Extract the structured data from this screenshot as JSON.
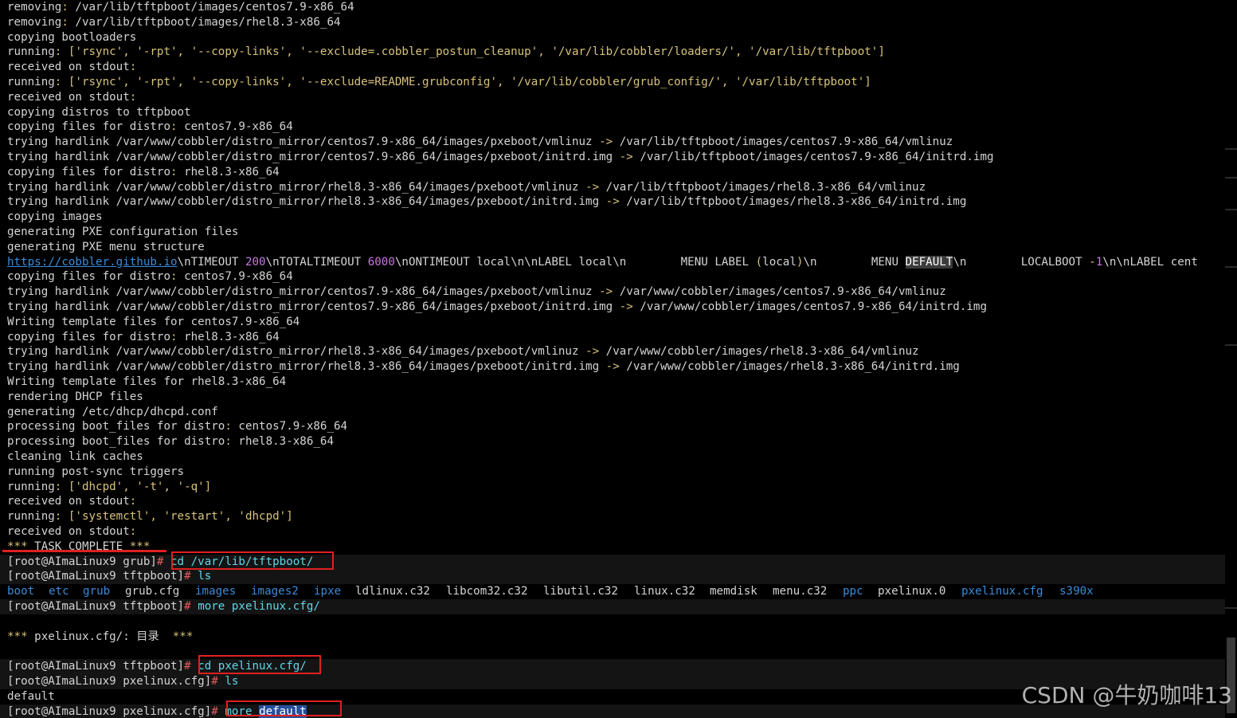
{
  "terminal": {
    "lines": [
      {
        "segments": [
          [
            "w",
            "removing"
          ],
          [
            "y",
            ":"
          ],
          [
            "w",
            " /var/lib/tftpboot/images/centos7.9-x86_64"
          ]
        ]
      },
      {
        "segments": [
          [
            "w",
            "removing"
          ],
          [
            "y",
            ":"
          ],
          [
            "w",
            " /var/lib/tftpboot/images/rhel8.3-x86_64"
          ]
        ]
      },
      {
        "segments": [
          [
            "w",
            "copying bootloaders"
          ]
        ]
      },
      {
        "segments": [
          [
            "w",
            "running"
          ],
          [
            "y",
            ": ['rsync', '-rpt', '--copy-links', '--exclude=.cobbler_postun_cleanup', '/var/lib/cobbler/loaders/', '/var/lib/tftpboot']"
          ]
        ]
      },
      {
        "segments": [
          [
            "w",
            "received on stdout"
          ],
          [
            "y",
            ":"
          ]
        ]
      },
      {
        "segments": [
          [
            "w",
            "running"
          ],
          [
            "y",
            ": ['rsync', '-rpt', '--copy-links', '--exclude=README.grubconfig', '/var/lib/cobbler/grub_config/', '/var/lib/tftpboot']"
          ]
        ]
      },
      {
        "segments": [
          [
            "w",
            "received on stdout"
          ],
          [
            "y",
            ":"
          ]
        ]
      },
      {
        "segments": [
          [
            "w",
            "copying distros to tftpboot"
          ]
        ]
      },
      {
        "segments": [
          [
            "w",
            "copying files for distro"
          ],
          [
            "y",
            ":"
          ],
          [
            "w",
            " centos7.9-x86_64"
          ]
        ]
      },
      {
        "segments": [
          [
            "w",
            "trying hardlink /var/www/cobbler/distro_mirror/centos7.9-x86_64/images/pxeboot/vmlinuz "
          ],
          [
            "y",
            "->"
          ],
          [
            "w",
            " /var/lib/tftpboot/images/centos7.9-x86_64/vmlinuz"
          ]
        ]
      },
      {
        "segments": [
          [
            "w",
            "trying hardlink /var/www/cobbler/distro_mirror/centos7.9-x86_64/images/pxeboot/initrd.img "
          ],
          [
            "y",
            "->"
          ],
          [
            "w",
            " /var/lib/tftpboot/images/centos7.9-x86_64/initrd.img"
          ]
        ]
      },
      {
        "segments": [
          [
            "w",
            "copying files for distro"
          ],
          [
            "y",
            ":"
          ],
          [
            "w",
            " rhel8.3-x86_64"
          ]
        ]
      },
      {
        "segments": [
          [
            "w",
            "trying hardlink /var/www/cobbler/distro_mirror/rhel8.3-x86_64/images/pxeboot/vmlinuz "
          ],
          [
            "y",
            "->"
          ],
          [
            "w",
            " /var/lib/tftpboot/images/rhel8.3-x86_64/vmlinuz"
          ]
        ]
      },
      {
        "segments": [
          [
            "w",
            "trying hardlink /var/www/cobbler/distro_mirror/rhel8.3-x86_64/images/pxeboot/initrd.img "
          ],
          [
            "y",
            "->"
          ],
          [
            "w",
            " /var/lib/tftpboot/images/rhel8.3-x86_64/initrd.img"
          ]
        ]
      },
      {
        "segments": [
          [
            "w",
            "copying images"
          ]
        ]
      },
      {
        "segments": [
          [
            "w",
            "generating PXE configuration files"
          ]
        ]
      },
      {
        "segments": [
          [
            "w",
            "generating PXE menu structure"
          ]
        ]
      },
      {
        "segments": [
          [
            "link",
            "https://cobbler.github.io"
          ],
          [
            "w",
            "\\nTIMEOUT "
          ],
          [
            "num",
            "200"
          ],
          [
            "w",
            "\\nTOTALTIMEOUT "
          ],
          [
            "num",
            "6000"
          ],
          [
            "w",
            "\\nONTIMEOUT local\\n\\nLABEL local\\n        MENU LABEL "
          ],
          [
            "y",
            "("
          ],
          [
            "w",
            "local"
          ],
          [
            "y",
            ")"
          ],
          [
            "w",
            "\\n        MENU "
          ],
          [
            "sel",
            "DEFAULT"
          ],
          [
            "w",
            "\\n        LOCALBOOT "
          ],
          [
            "y",
            "-"
          ],
          [
            "num",
            "1"
          ],
          [
            "w",
            "\\n\\nLABEL cent"
          ]
        ]
      },
      {
        "segments": [
          [
            "w",
            "copying files for distro"
          ],
          [
            "y",
            ":"
          ],
          [
            "w",
            " centos7.9-x86_64"
          ]
        ]
      },
      {
        "segments": [
          [
            "w",
            "trying hardlink /var/www/cobbler/distro_mirror/centos7.9-x86_64/images/pxeboot/vmlinuz "
          ],
          [
            "y",
            "->"
          ],
          [
            "w",
            " /var/www/cobbler/images/centos7.9-x86_64/vmlinuz"
          ]
        ]
      },
      {
        "segments": [
          [
            "w",
            "trying hardlink /var/www/cobbler/distro_mirror/centos7.9-x86_64/images/pxeboot/initrd.img "
          ],
          [
            "y",
            "->"
          ],
          [
            "w",
            " /var/www/cobbler/images/centos7.9-x86_64/initrd.img"
          ]
        ]
      },
      {
        "segments": [
          [
            "w",
            "Writing template files for centos7.9-x86_64"
          ]
        ]
      },
      {
        "segments": [
          [
            "w",
            "copying files for distro"
          ],
          [
            "y",
            ":"
          ],
          [
            "w",
            " rhel8.3-x86_64"
          ]
        ]
      },
      {
        "segments": [
          [
            "w",
            "trying hardlink /var/www/cobbler/distro_mirror/rhel8.3-x86_64/images/pxeboot/vmlinuz "
          ],
          [
            "y",
            "->"
          ],
          [
            "w",
            " /var/www/cobbler/images/rhel8.3-x86_64/vmlinuz"
          ]
        ]
      },
      {
        "segments": [
          [
            "w",
            "trying hardlink /var/www/cobbler/distro_mirror/rhel8.3-x86_64/images/pxeboot/initrd.img "
          ],
          [
            "y",
            "->"
          ],
          [
            "w",
            " /var/www/cobbler/images/rhel8.3-x86_64/initrd.img"
          ]
        ]
      },
      {
        "segments": [
          [
            "w",
            "Writing template files for rhel8.3-x86_64"
          ]
        ]
      },
      {
        "segments": [
          [
            "w",
            "rendering DHCP files"
          ]
        ]
      },
      {
        "segments": [
          [
            "w",
            "generating /etc/dhcp/dhcpd.conf"
          ]
        ]
      },
      {
        "segments": [
          [
            "w",
            "processing boot_files for distro"
          ],
          [
            "y",
            ":"
          ],
          [
            "w",
            " centos7.9-x86_64"
          ]
        ]
      },
      {
        "segments": [
          [
            "w",
            "processing boot_files for distro"
          ],
          [
            "y",
            ":"
          ],
          [
            "w",
            " rhel8.3-x86_64"
          ]
        ]
      },
      {
        "segments": [
          [
            "w",
            "cleaning link caches"
          ]
        ]
      },
      {
        "segments": [
          [
            "w",
            "running post-sync triggers"
          ]
        ]
      },
      {
        "segments": [
          [
            "w",
            "running"
          ],
          [
            "y",
            ": ['dhcpd', '-t', '-q']"
          ]
        ]
      },
      {
        "segments": [
          [
            "w",
            "received on stdout"
          ],
          [
            "y",
            ":"
          ]
        ]
      },
      {
        "segments": [
          [
            "w",
            "running"
          ],
          [
            "y",
            ": ['systemctl', 'restart', 'dhcpd']"
          ]
        ]
      },
      {
        "segments": [
          [
            "w",
            "received on stdout"
          ],
          [
            "y",
            ":"
          ]
        ]
      },
      {
        "segments": [
          [
            "y",
            "***"
          ],
          [
            "w",
            " TASK COMPLETE "
          ],
          [
            "y",
            "***"
          ]
        ]
      },
      {
        "highlight": true,
        "segments": [
          [
            "w",
            "[root@AImaLinux9 grub]"
          ],
          [
            "ex",
            "#"
          ],
          [
            "w",
            " "
          ],
          [
            "cmd",
            "cd /var/lib/tftpboot/"
          ]
        ]
      },
      {
        "highlight": true,
        "segments": [
          [
            "w",
            "[root@AImaLinux9 tftpboot]"
          ],
          [
            "ex",
            "#"
          ],
          [
            "w",
            " "
          ],
          [
            "cmd",
            "ls"
          ]
        ]
      },
      {
        "ls": true,
        "segments": []
      },
      {
        "highlight": true,
        "segments": [
          [
            "w",
            "[root@AImaLinux9 tftpboot]"
          ],
          [
            "ex",
            "#"
          ],
          [
            "w",
            " "
          ],
          [
            "cmd",
            "more pxelinux.cfg/"
          ]
        ]
      },
      {
        "segments": []
      },
      {
        "segments": [
          [
            "y",
            "***"
          ],
          [
            "w",
            " pxelinux.cfg/: 目录  "
          ],
          [
            "y",
            "***"
          ]
        ]
      },
      {
        "segments": []
      },
      {
        "highlight": true,
        "segments": [
          [
            "w",
            "[root@AImaLinux9 tftpboot]"
          ],
          [
            "ex",
            "#"
          ],
          [
            "w",
            " "
          ],
          [
            "cmd",
            "cd pxelinux.cfg/"
          ]
        ]
      },
      {
        "highlight": true,
        "segments": [
          [
            "w",
            "[root@AImaLinux9 pxelinux.cfg]"
          ],
          [
            "ex",
            "#"
          ],
          [
            "w",
            " "
          ],
          [
            "cmd",
            "ls"
          ]
        ]
      },
      {
        "segments": [
          [
            "w",
            "default"
          ]
        ]
      },
      {
        "highlight": true,
        "segments": [
          [
            "w",
            "[root@AImaLinux9 pxelinux.cfg]"
          ],
          [
            "ex",
            "#"
          ],
          [
            "w",
            " "
          ],
          [
            "cmd",
            "more "
          ],
          [
            "seldefault",
            "default"
          ]
        ]
      }
    ],
    "ls_listing": [
      {
        "name": "boot",
        "kind": "dir"
      },
      {
        "name": "etc",
        "kind": "dir"
      },
      {
        "name": "grub",
        "kind": "dir"
      },
      {
        "name": "grub.cfg",
        "kind": "file"
      },
      {
        "name": "images",
        "kind": "dir"
      },
      {
        "name": "images2",
        "kind": "dir"
      },
      {
        "name": "ipxe",
        "kind": "dir"
      },
      {
        "name": "ldlinux.c32",
        "kind": "file"
      },
      {
        "name": "libcom32.c32",
        "kind": "file"
      },
      {
        "name": "libutil.c32",
        "kind": "file"
      },
      {
        "name": "linux.c32",
        "kind": "file"
      },
      {
        "name": "memdisk",
        "kind": "file"
      },
      {
        "name": "menu.c32",
        "kind": "file"
      },
      {
        "name": "ppc",
        "kind": "dir"
      },
      {
        "name": "pxelinux.0",
        "kind": "file"
      },
      {
        "name": "pxelinux.cfg",
        "kind": "dir"
      },
      {
        "name": "s390x",
        "kind": "dir"
      }
    ],
    "colors": {
      "background": "#000000",
      "text": "#d4d4d4",
      "punctuation": "#d7c27a",
      "command": "#5fd7e6",
      "directory": "#3b8bd9",
      "number": "#c678dd",
      "annotation": "#e02020"
    }
  },
  "watermark": {
    "text": "CSDN @牛奶咖啡13"
  }
}
